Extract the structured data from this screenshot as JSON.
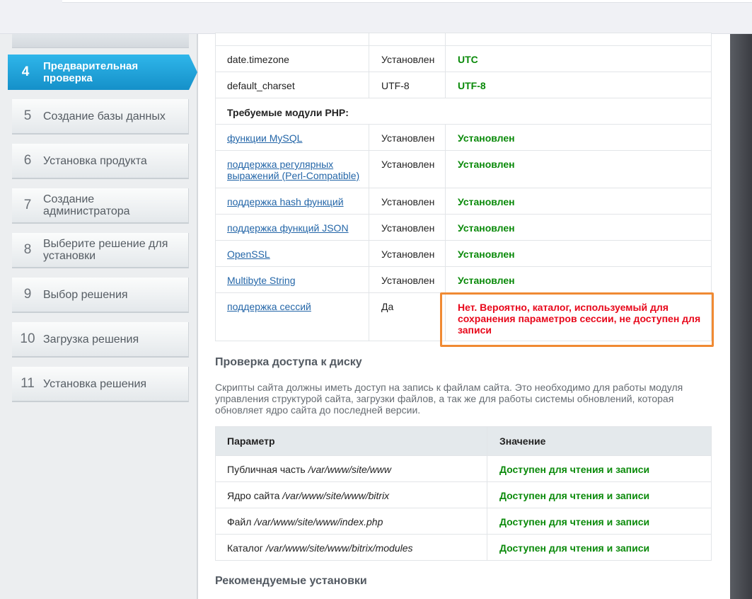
{
  "sidebar": {
    "steps": [
      {
        "num": "4",
        "label": "Предварительная проверка",
        "active": true
      },
      {
        "num": "5",
        "label": "Создание базы данных"
      },
      {
        "num": "6",
        "label": "Установка продукта"
      },
      {
        "num": "7",
        "label": "Создание администратора"
      },
      {
        "num": "8",
        "label": "Выберите решение для установки"
      },
      {
        "num": "9",
        "label": "Выбор решения"
      },
      {
        "num": "10",
        "label": "Загрузка решения"
      },
      {
        "num": "11",
        "label": "Установка решения"
      }
    ]
  },
  "settings_table": {
    "rows": [
      {
        "param": "date.timezone",
        "required": "Установлен",
        "current": "UTC"
      },
      {
        "param": "default_charset",
        "required": "UTF-8",
        "current": "UTF-8"
      }
    ],
    "modules_heading": "Требуемые модули PHP:",
    "modules": [
      {
        "param": "функции MySQL",
        "required": "Установлен",
        "current": "Установлен"
      },
      {
        "param": "поддержка регулярных выражений (Perl-Compatible)",
        "required": "Установлен",
        "current": "Установлен"
      },
      {
        "param": "поддержка hash функций",
        "required": "Установлен",
        "current": "Установлен"
      },
      {
        "param": "поддержка функций JSON",
        "required": "Установлен",
        "current": "Установлен"
      },
      {
        "param": "OpenSSL",
        "required": "Установлен",
        "current": "Установлен"
      },
      {
        "param": "Multibyte String",
        "required": "Установлен",
        "current": "Установлен"
      },
      {
        "param": "поддержка сессий",
        "required": "Да",
        "current": "Нет. Вероятно, каталог, используемый для сохранения параметров сессии, не доступен для записи"
      }
    ]
  },
  "disk_section": {
    "title": "Проверка доступа к диску",
    "description": "Скрипты сайта должны иметь доступ на запись к файлам сайта. Это необходимо для работы модуля управления структурой сайта, загрузки файлов, а так же для работы системы обновлений, которая обновляет ядро сайта до последней версии.",
    "header": {
      "param": "Параметр",
      "value": "Значение"
    },
    "rows": [
      {
        "label": "Публичная часть ",
        "path": "/var/www/site/www",
        "value": "Доступен для чтения и записи"
      },
      {
        "label": "Ядро сайта ",
        "path": "/var/www/site/www/bitrix",
        "value": "Доступен для чтения и записи"
      },
      {
        "label": "Файл ",
        "path": "/var/www/site/www/index.php",
        "value": "Доступен для чтения и записи"
      },
      {
        "label": "Каталог ",
        "path": "/var/www/site/www/bitrix/modules",
        "value": "Доступен для чтения и записи"
      }
    ]
  },
  "recommended_section": {
    "title": "Рекомендуемые установки"
  },
  "colors": {
    "accent": "#1a9fd8",
    "ok": "#0a8a0a",
    "error": "#e8081b",
    "highlight": "#f08a33"
  }
}
